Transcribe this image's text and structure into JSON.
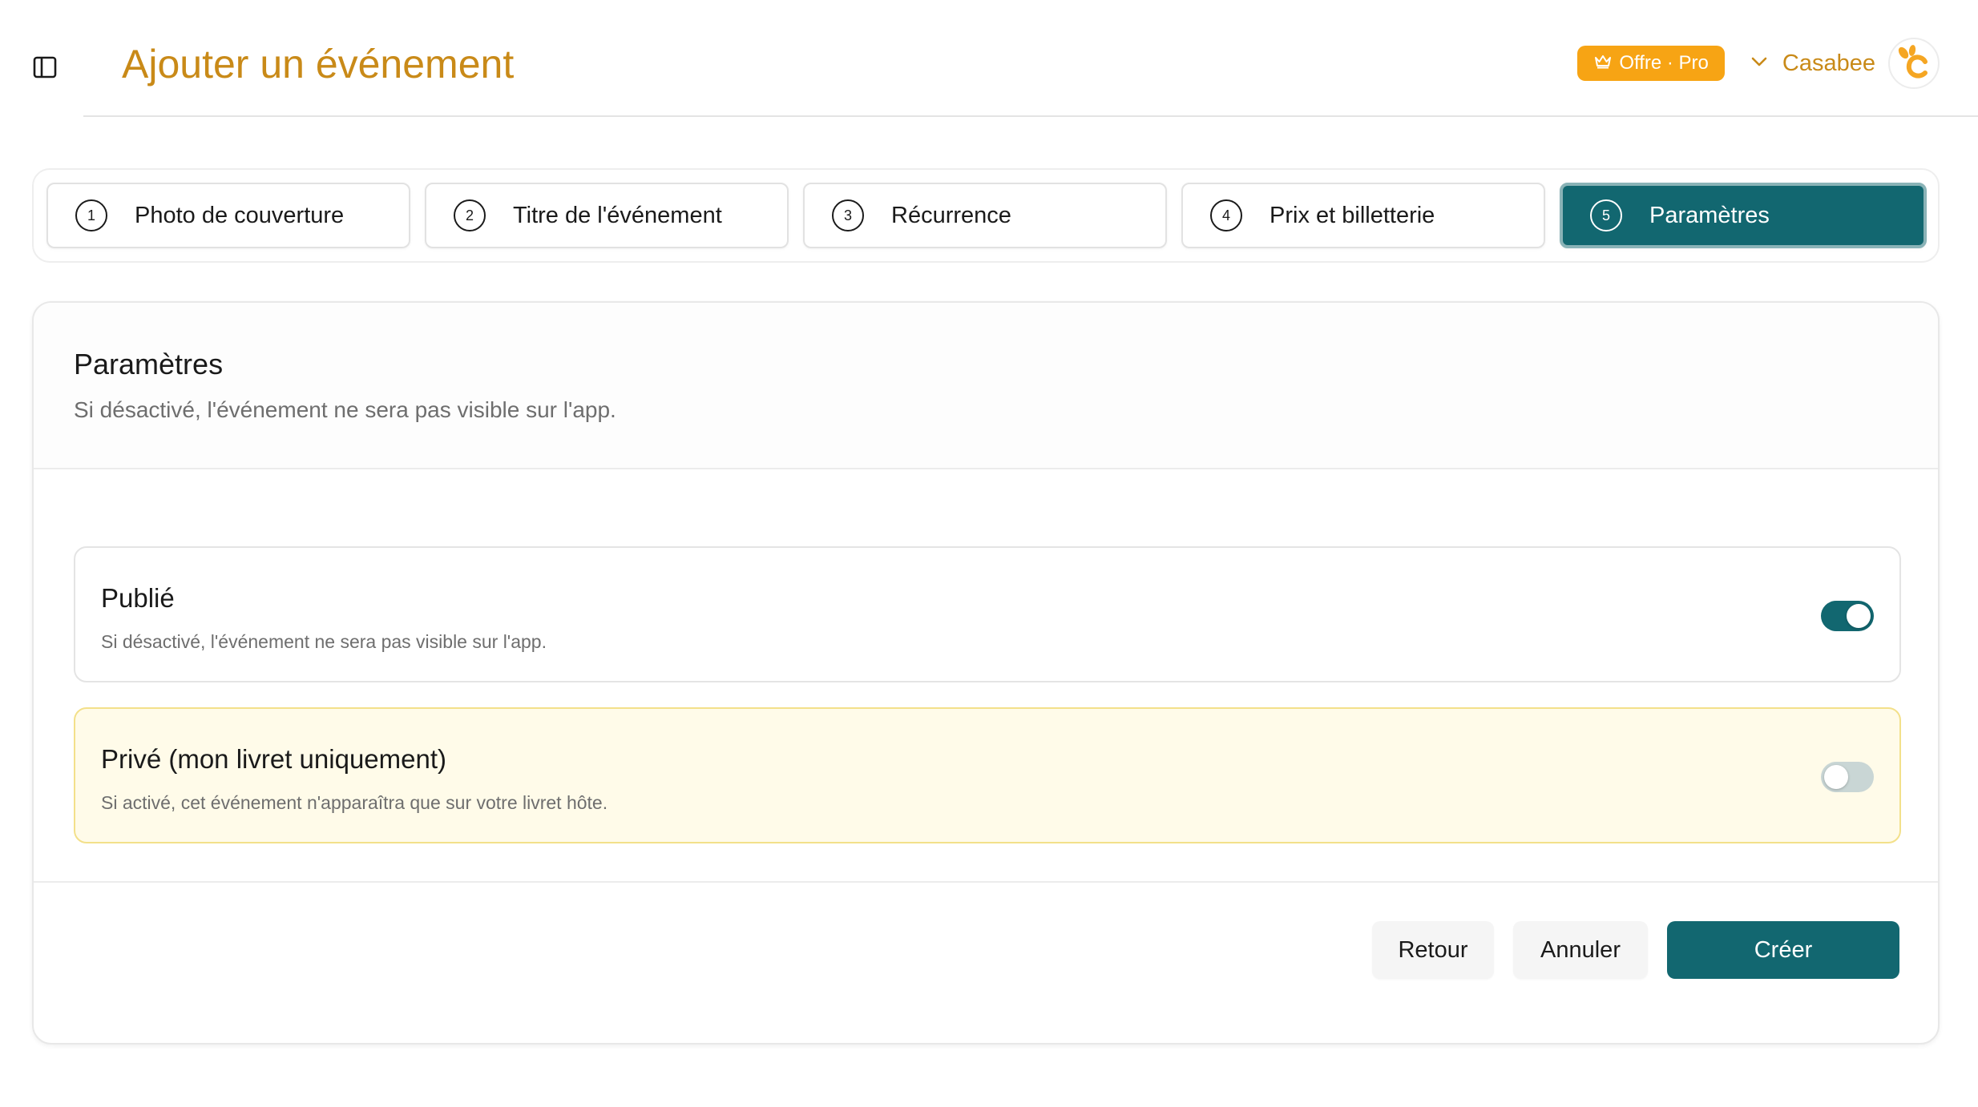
{
  "colors": {
    "accent": "#126770",
    "title": "#c98a18",
    "badge": "#f7a414",
    "warning_bg": "#fffbe9",
    "toggle_off": "#c9d6d5"
  },
  "header": {
    "title": "Ajouter un événement",
    "sidebar_icon": "sidebar-toggle-icon",
    "plan_badge": {
      "icon": "crown-icon",
      "label": "Offre · Pro"
    },
    "account": {
      "name": "Casabee",
      "chevron_icon": "chevron-down-icon",
      "avatar_logo": "casabee-logo"
    }
  },
  "steps": [
    {
      "number": "1",
      "label": "Photo de couverture",
      "active": false
    },
    {
      "number": "2",
      "label": "Titre de l'événement",
      "active": false
    },
    {
      "number": "3",
      "label": "Récurrence",
      "active": false
    },
    {
      "number": "4",
      "label": "Prix et billetterie",
      "active": false
    },
    {
      "number": "5",
      "label": "Paramètres",
      "active": true
    }
  ],
  "section": {
    "title": "Paramètres",
    "subtitle": "Si désactivé, l'événement ne sera pas visible sur l'app."
  },
  "settings": [
    {
      "title": "Publié",
      "description": "Si désactivé, l'événement ne sera pas visible sur l'app.",
      "enabled": true
    },
    {
      "title": "Privé (mon livret uniquement)",
      "description": "Si activé, cet événement n'apparaîtra que sur votre livret hôte.",
      "enabled": false
    }
  ],
  "actions": {
    "back": "Retour",
    "cancel": "Annuler",
    "create": "Créer"
  }
}
